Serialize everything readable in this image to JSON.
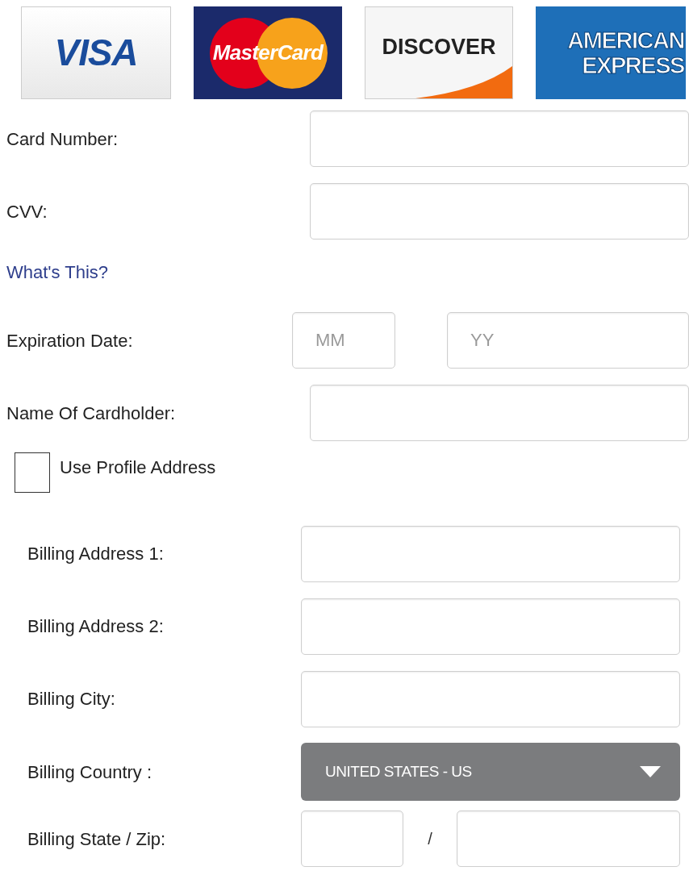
{
  "card_logos": [
    {
      "kind": "visa",
      "lines": [
        "VISA"
      ]
    },
    {
      "kind": "mastercard",
      "lines": [
        "MasterCard"
      ]
    },
    {
      "kind": "discover",
      "lines": [
        "DISCOVER"
      ]
    },
    {
      "kind": "amex",
      "lines": [
        "AMERICAN",
        "EXPRESS"
      ]
    }
  ],
  "card_fields": [
    {
      "kind": "text",
      "label": "Card Number:"
    },
    {
      "kind": "text",
      "label": "CVV:"
    },
    {
      "kind": "link",
      "label": "What's This?"
    },
    {
      "kind": "date",
      "label": "Expiration Date:",
      "month_placeholder": "MM",
      "year_placeholder": "YY"
    },
    {
      "kind": "text",
      "label": "Name Of Cardholder:"
    }
  ],
  "use_profile_address": {
    "label": "Use Profile Address",
    "checked": false
  },
  "billing_fields": [
    {
      "kind": "text",
      "label": "Billing Address 1:"
    },
    {
      "kind": "text",
      "label": "Billing Address 2:"
    },
    {
      "kind": "text",
      "label": "Billing City:"
    },
    {
      "kind": "select",
      "label": "Billing Country :",
      "value": "UNITED STATES - US"
    },
    {
      "kind": "state_zip",
      "label": "Billing State / Zip:",
      "separator": "/"
    }
  ]
}
